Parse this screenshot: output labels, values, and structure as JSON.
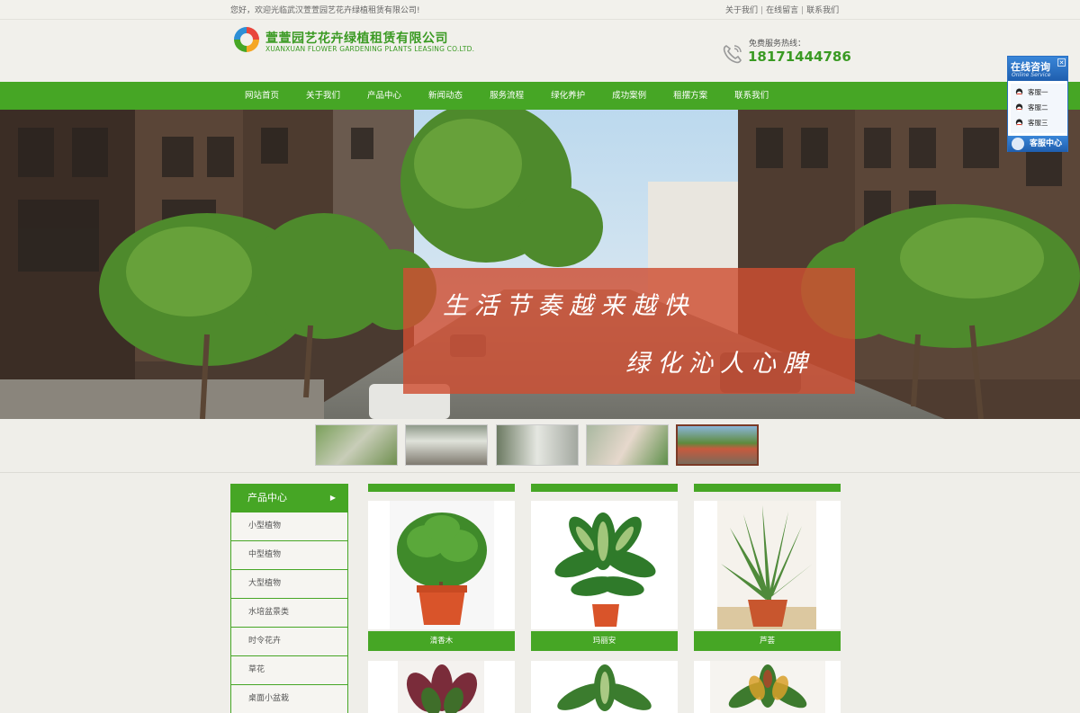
{
  "topbar": {
    "welcome": "您好，欢迎光临武汉萱萱园艺花卉绿植租赁有限公司!",
    "links": [
      "关于我们",
      "在线留言",
      "联系我们"
    ]
  },
  "header": {
    "company_name": "萱萱园艺花卉绿植租赁有限公司",
    "company_en": "XUANXUAN  FLOWER GARDENING PLANTS LEASING CO.LTD.",
    "hotline_label": "免费服务热线：",
    "hotline_number": "18171444786"
  },
  "nav": {
    "items": [
      "网站首页",
      "关于我们",
      "产品中心",
      "新闻动态",
      "服务流程",
      "绿化养护",
      "成功案例",
      "租摆方案",
      "联系我们"
    ]
  },
  "banner": {
    "slogan_line1": "生活节奏越来越快",
    "slogan_line2": "绿化沁人心脾",
    "thumbnail_count": 5,
    "active_thumbnail": 5
  },
  "sidebar": {
    "title": "产品中心",
    "items": [
      "小型植物",
      "中型植物",
      "大型植物",
      "水培盆景类",
      "时令花卉",
      "草花",
      "桌面小盆栽"
    ]
  },
  "products": {
    "row1": [
      "清香木",
      "玛丽安",
      "芦荟"
    ]
  },
  "online_service": {
    "title": "在线咨询",
    "subtitle": "Online Service",
    "agents": [
      "客服一",
      "客服二",
      "客服三"
    ],
    "footer": "客服中心"
  },
  "colors": {
    "brand_green": "#46a625",
    "banner_box": "#ce4e32",
    "service_blue": "#2a6fc2"
  }
}
